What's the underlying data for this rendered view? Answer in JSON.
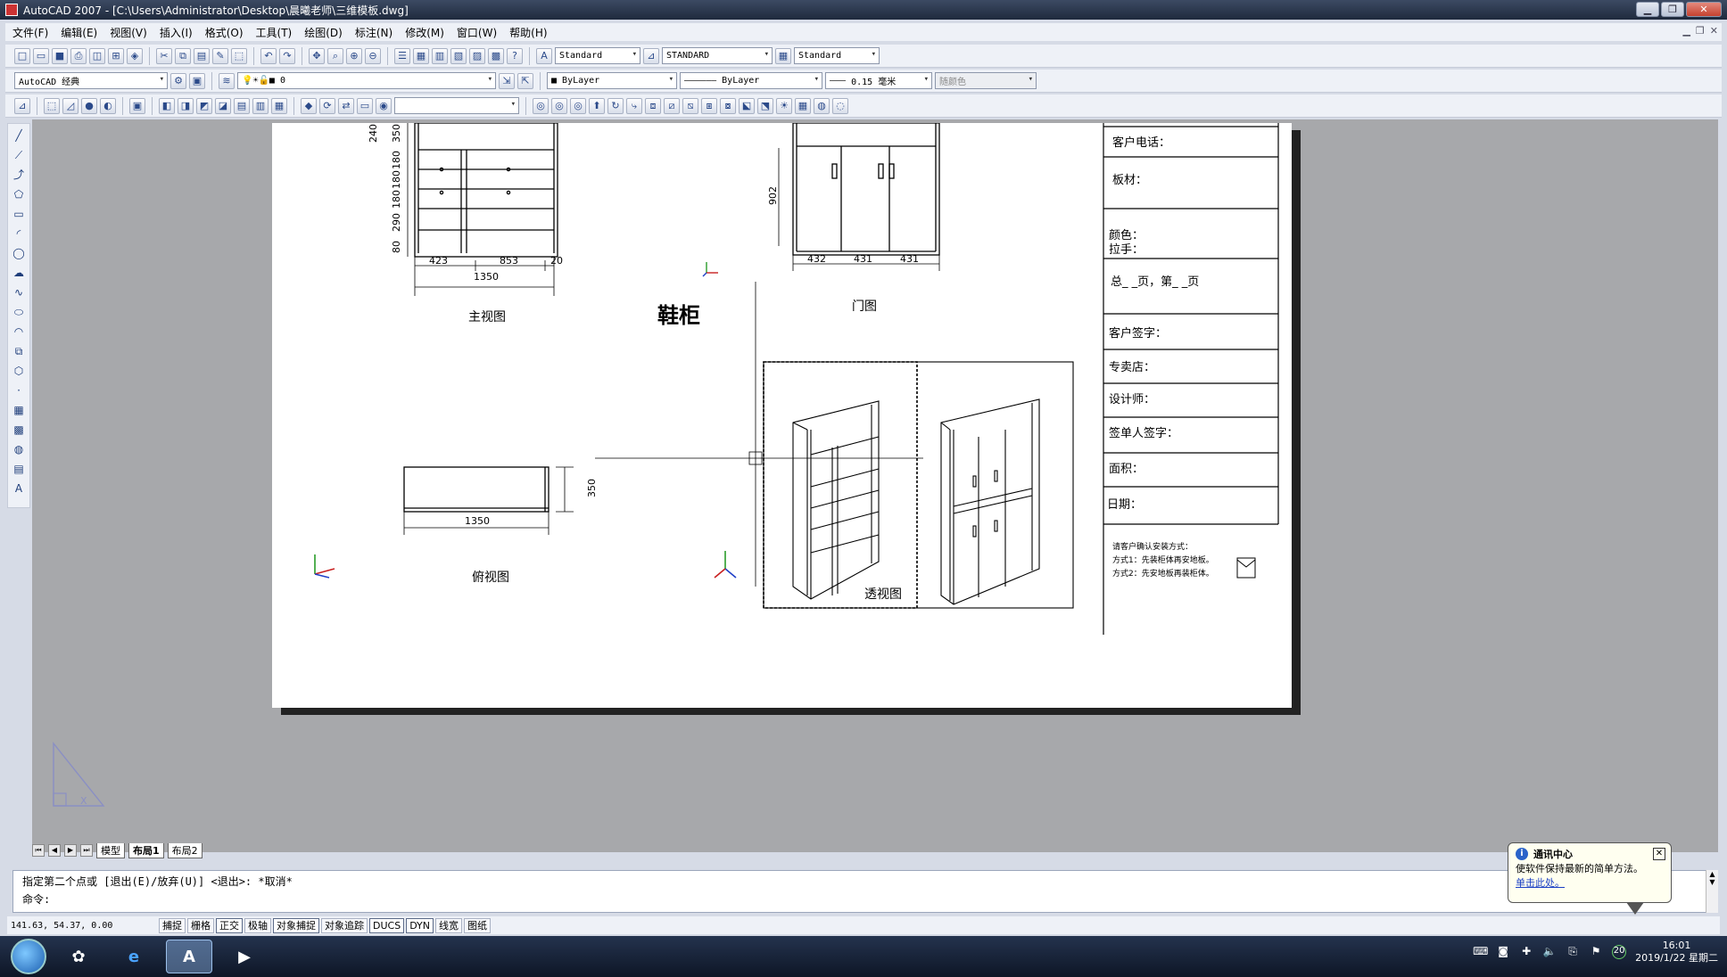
{
  "window": {
    "title": "AutoCAD 2007 - [C:\\Users\\Administrator\\Desktop\\晨曦老师\\三维模板.dwg]",
    "min": "▁",
    "restore": "❐",
    "close": "✕"
  },
  "menu": {
    "items": [
      "文件(F)",
      "编辑(E)",
      "视图(V)",
      "插入(I)",
      "格式(O)",
      "工具(T)",
      "绘图(D)",
      "标注(N)",
      "修改(M)",
      "窗口(W)",
      "帮助(H)"
    ]
  },
  "toolbar1": {
    "text_style": "Standard",
    "dim_style": "STANDARD",
    "table_style": "Standard"
  },
  "toolbar2": {
    "workspace": "AutoCAD 经典",
    "layer": "0",
    "color": "ByLayer",
    "linetype": "ByLayer",
    "lineweight": "0.15 毫米",
    "plotstyle": "随颜色"
  },
  "drawing": {
    "title": "鞋柜",
    "views": {
      "main": "主视图",
      "door": "门图",
      "top": "俯视图",
      "persp": "透视图"
    },
    "dims_main": {
      "h": [
        "240",
        "350",
        "180",
        "180",
        "180",
        "290",
        "80"
      ],
      "w": [
        "423",
        "853",
        "20"
      ],
      "total": "1350"
    },
    "dims_door": {
      "h": "902",
      "w": [
        "432",
        "431",
        "431"
      ]
    },
    "dims_top": {
      "w": "1350",
      "d": "350"
    },
    "titleblock": {
      "phone": "客户电话：",
      "board": "板材：",
      "color": "颜色：",
      "handle": "拉手：",
      "pages": "总_ _页，第_ _页",
      "signature": "客户签字：",
      "store": "专卖店：",
      "designer": "设计师：",
      "signer": "签单人签字：",
      "area": "面积：",
      "date": "日期：",
      "note1": "请客户确认安装方式：",
      "note2": "方式1：先装柜体再安地板。",
      "note3": "方式2：先安地板再装柜体。"
    }
  },
  "tabs": {
    "model": "模型",
    "layout1": "布局1",
    "layout2": "布局2"
  },
  "command": {
    "line1": "指定第二个点或 [退出(E)/放弃(U)] <退出>:  *取消*",
    "line2": "命令:"
  },
  "status": {
    "coords": "141.63, 54.37, 0.00",
    "buttons": [
      "捕捉",
      "栅格",
      "正交",
      "极轴",
      "对象捕捉",
      "对象追踪",
      "DUCS",
      "DYN",
      "线宽",
      "图纸"
    ]
  },
  "balloon": {
    "title": "通讯中心",
    "text": "使软件保持最新的简单方法。",
    "link": "单击此处。"
  },
  "taskbar": {
    "time": "16:01",
    "date": "2019/1/22 星期二",
    "badge": "20"
  }
}
